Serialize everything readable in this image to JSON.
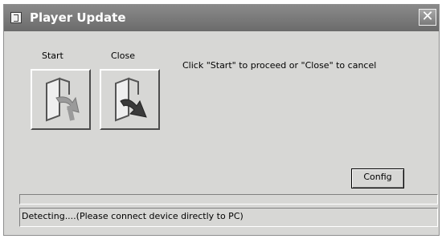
{
  "window": {
    "title": "Player Update",
    "close_glyph": "✕"
  },
  "buttons": {
    "start_label": "Start",
    "close_label": "Close",
    "start_icon": "open-door-arrow-icon",
    "close_icon": "exit-door-arrow-icon",
    "config_label": "Config"
  },
  "instruction": "Click \"Start\" to proceed or \"Close\" to cancel",
  "progress": {
    "value": 0
  },
  "status": "Detecting....(Please connect device directly to PC)",
  "colors": {
    "titlebar": "#6b6b6b",
    "window_bg": "#d7d7d5",
    "title_text": "#ffffff"
  }
}
